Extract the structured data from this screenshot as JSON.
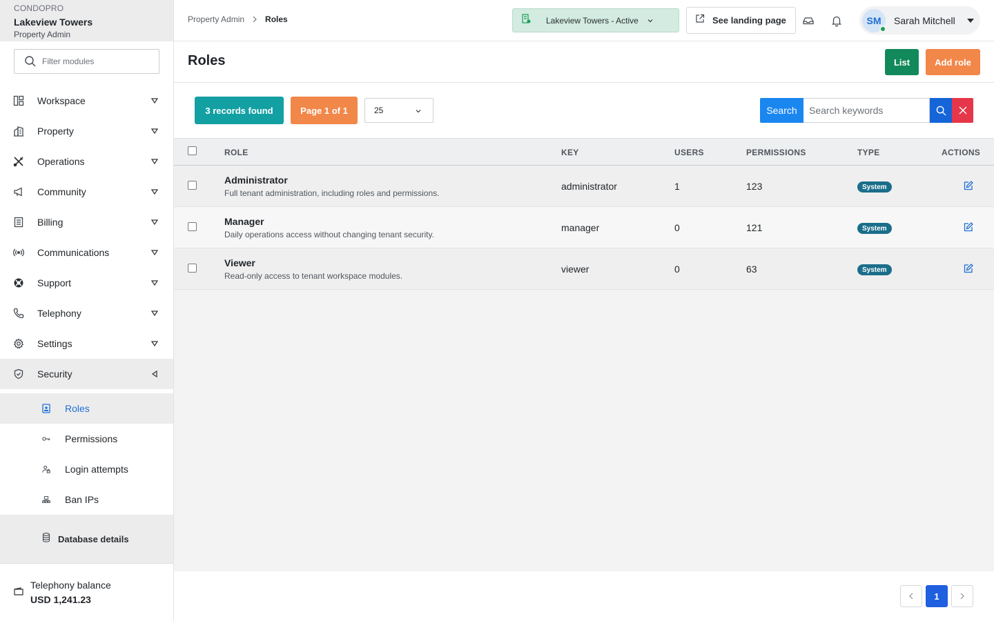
{
  "brand": {
    "org": "CONDOPRO",
    "tenant": "Lakeview Towers",
    "role": "Property Admin"
  },
  "sidebar": {
    "filter_placeholder": "Filter modules",
    "items": [
      {
        "label": "Workspace",
        "icon": "workspace-icon"
      },
      {
        "label": "Property",
        "icon": "building-icon"
      },
      {
        "label": "Operations",
        "icon": "tools-icon"
      },
      {
        "label": "Community",
        "icon": "megaphone-icon"
      },
      {
        "label": "Billing",
        "icon": "receipt-icon"
      },
      {
        "label": "Communications",
        "icon": "broadcast-icon"
      },
      {
        "label": "Support",
        "icon": "lifebuoy-icon"
      },
      {
        "label": "Telephony",
        "icon": "phone-icon"
      },
      {
        "label": "Settings",
        "icon": "gear-icon"
      },
      {
        "label": "Security",
        "icon": "shield-icon"
      }
    ],
    "security_sub": [
      {
        "label": "Roles",
        "icon": "id-badge-icon"
      },
      {
        "label": "Permissions",
        "icon": "key-icon"
      },
      {
        "label": "Login attempts",
        "icon": "user-lock-icon"
      },
      {
        "label": "Ban IPs",
        "icon": "network-icon"
      }
    ],
    "database_details": "Database details",
    "balance_label": "Telephony balance",
    "balance_value": "USD 1,241.23"
  },
  "header": {
    "breadcrumb": [
      "Property Admin",
      "Roles"
    ],
    "tenant_select": "Lakeview Towers - Active",
    "landing_label": "See landing page",
    "user_initials": "SM",
    "user_name": "Sarah Mitchell"
  },
  "page": {
    "title": "Roles",
    "list_label": "List",
    "add_label": "Add role"
  },
  "toolbar": {
    "records": "3 records found",
    "page": "Page 1 of 1",
    "per_page": "25",
    "search_label": "Search",
    "search_placeholder": "Search keywords"
  },
  "table": {
    "columns": [
      "ROLE",
      "KEY",
      "USERS",
      "PERMISSIONS",
      "TYPE",
      "ACTIONS"
    ],
    "rows": [
      {
        "name": "Administrator",
        "desc": "Full tenant administration, including roles and permissions.",
        "key": "administrator",
        "users": "1",
        "permissions": "123",
        "type": "System"
      },
      {
        "name": "Manager",
        "desc": "Daily operations access without changing tenant security.",
        "key": "manager",
        "users": "0",
        "permissions": "121",
        "type": "System"
      },
      {
        "name": "Viewer",
        "desc": "Read-only access to tenant workspace modules.",
        "key": "viewer",
        "users": "0",
        "permissions": "63",
        "type": "System"
      }
    ]
  },
  "pagination": {
    "current": "1"
  },
  "colors": {
    "primary_blue": "#1a86f0",
    "green": "#12895a",
    "orange": "#f2874a",
    "teal": "#13a0a3",
    "red": "#e5364a",
    "system_badge": "#1b6e8a"
  }
}
